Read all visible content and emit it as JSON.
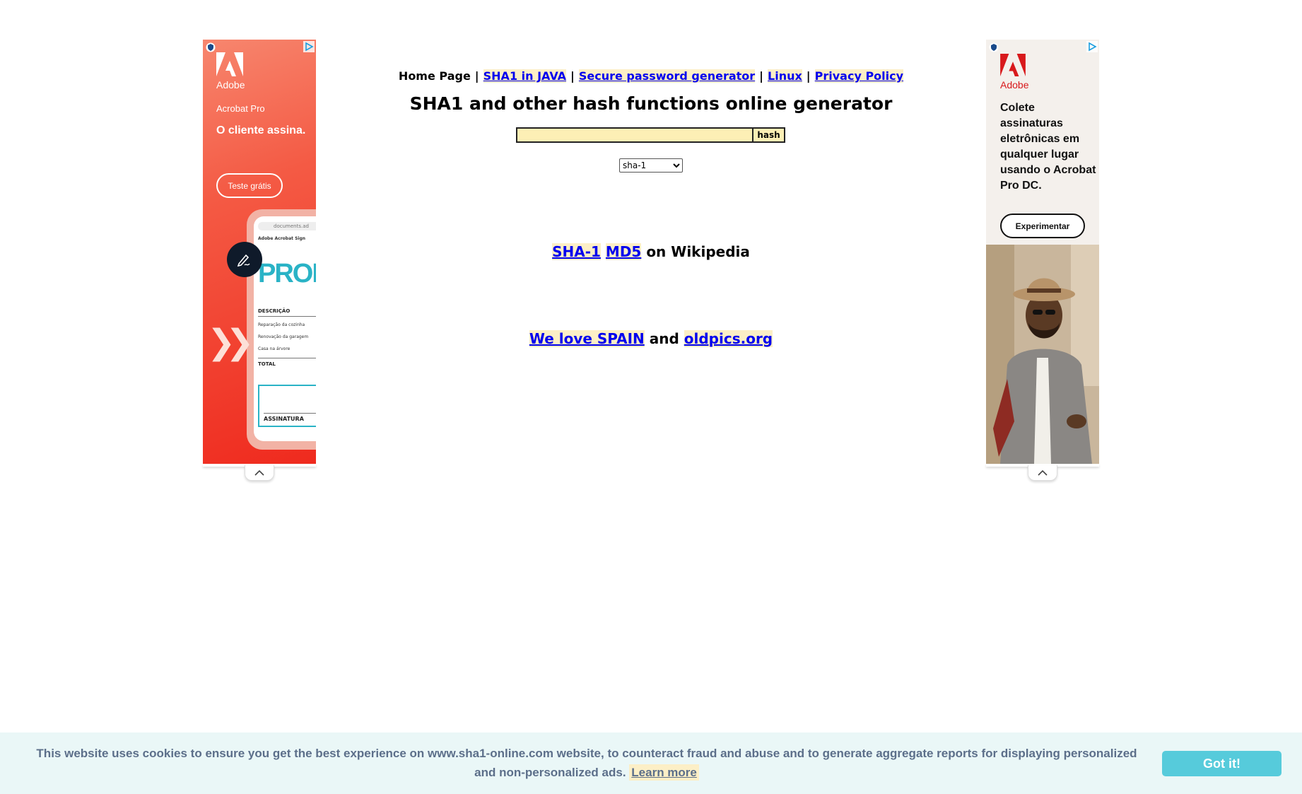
{
  "nav": {
    "home": "Home Page",
    "separator": "|",
    "links": [
      "SHA1 in JAVA",
      "Secure password generator",
      "Linux",
      "Privacy Policy"
    ]
  },
  "title": "SHA1 and other hash functions online generator",
  "form": {
    "input_value": "",
    "button_label": "hash",
    "algorithm_selected": "sha-1"
  },
  "wiki": {
    "link1": "SHA-1",
    "link2": "MD5",
    "suffix": "on Wikipedia"
  },
  "love": {
    "link1": "We love SPAIN",
    "middle": "and",
    "link2": "oldpics.org"
  },
  "ad_left": {
    "brand": "Adobe",
    "product": "Acrobat Pro",
    "tagline": "O cliente assina.",
    "cta": "Teste grátis",
    "phone_url": "documents.ad",
    "phone_app": "Adobe Acrobat Sign",
    "phone_heading": "PROPO",
    "phone_desc": "DESCRIÇÃO",
    "phone_rows": [
      "Reparação da cozinha",
      "Renovação da garagem",
      "Casa na árvore"
    ],
    "phone_total": "TOTAL",
    "phone_signature": "ASSINATURA",
    "accent_color": "#ef2a1e"
  },
  "ad_right": {
    "brand": "Adobe",
    "copy": "Colete assinaturas eletrônicas em qualquer lugar usando o Acrobat Pro DC.",
    "cta": "Experimentar",
    "accent_color": "#d8191c"
  },
  "cookie": {
    "text": "This website uses cookies to ensure you get the best experience on www.sha1-online.com website, to counteract fraud and abuse and to generate aggregate reports for displaying personalized and non-personalized ads.",
    "learn_more": "Learn more",
    "button": "Got it!",
    "button_color": "#56cbdb"
  },
  "icons": [
    "adchoices-icon",
    "ad-info-icon",
    "chevron-up-icon",
    "adobe-logo-icon",
    "pen-signature-icon"
  ]
}
